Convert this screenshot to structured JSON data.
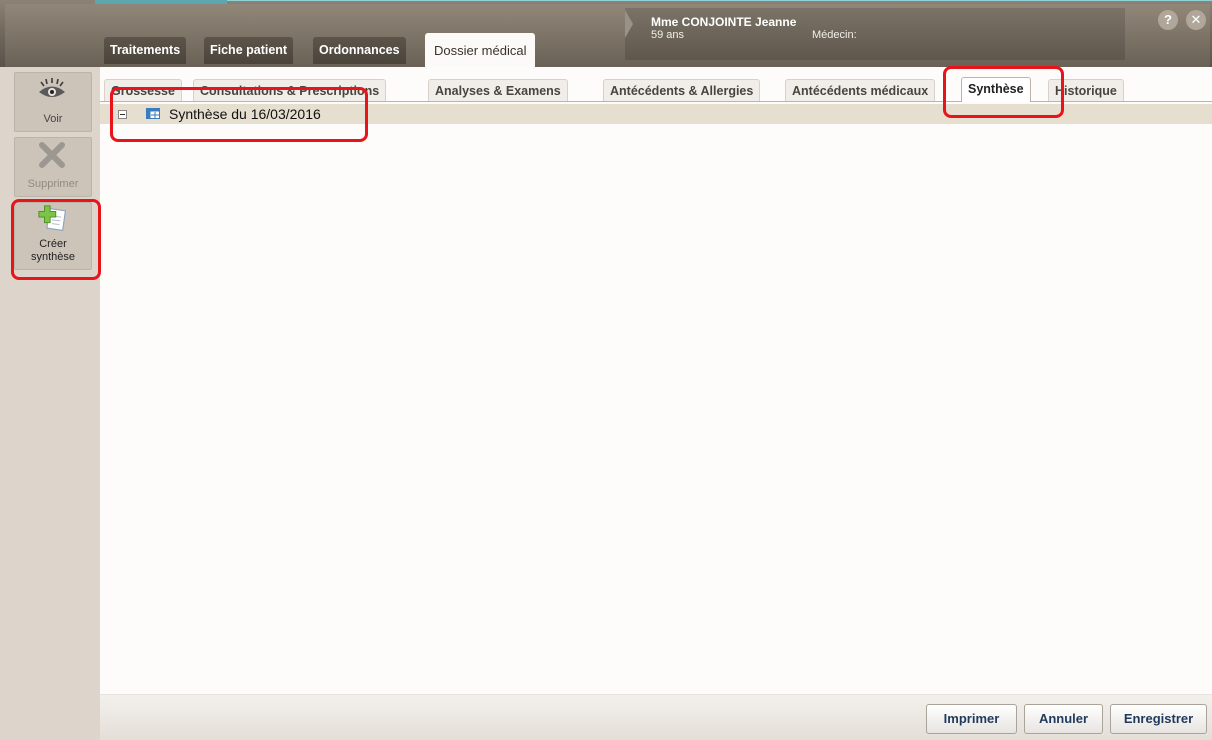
{
  "header": {
    "patient_name": "Mme CONJOINTE Jeanne",
    "patient_age": "59 ans",
    "doctor_label": "Médecin:",
    "help_label": "?",
    "close_label": "✕"
  },
  "main_tabs": [
    {
      "label": "Traitements",
      "active": false
    },
    {
      "label": "Fiche patient",
      "active": false
    },
    {
      "label": "Ordonnances",
      "active": false
    },
    {
      "label": "Dossier médical",
      "active": true
    }
  ],
  "sidebar": {
    "view_label": "Voir",
    "delete_label": "Supprimer",
    "create_label_line1": "Créer",
    "create_label_line2": "synthèse"
  },
  "sub_tabs": [
    {
      "label": "Grossesse",
      "active": false
    },
    {
      "label": "Consultations & Prescriptions",
      "active": false
    },
    {
      "label": "Analyses & Examens",
      "active": false
    },
    {
      "label": "Antécédents & Allergies",
      "active": false
    },
    {
      "label": "Antécédents médicaux",
      "active": false
    },
    {
      "label": "Synthèse",
      "active": true
    },
    {
      "label": "Historique",
      "active": false
    }
  ],
  "tree": {
    "items": [
      {
        "label": "Synthèse du 16/03/2016",
        "expanded": true
      }
    ]
  },
  "footer": {
    "print_label": "Imprimer",
    "cancel_label": "Annuler",
    "save_label": "Enregistrer"
  },
  "colors": {
    "header_brown": "#6e655a",
    "tab_dark": "#4b443b",
    "sidebar_bg": "#ddd5cb",
    "tree_row_bg": "#e6dfd0",
    "annotation_red": "#e8141b",
    "button_text": "#1f3a5c"
  },
  "icons": {
    "view": "eye-icon",
    "delete": "cross-icon",
    "create": "add-document-icon",
    "tree_toggle": "collapse-icon",
    "tree_item": "table-icon"
  }
}
